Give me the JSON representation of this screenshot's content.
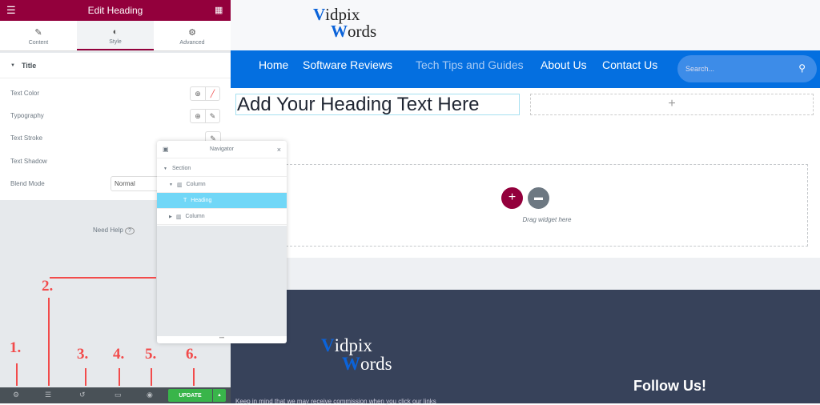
{
  "panel": {
    "title": "Edit Heading",
    "tabs": [
      "Content",
      "Style",
      "Advanced"
    ],
    "section": "Title",
    "rows": [
      "Text Color",
      "Typography",
      "Text Stroke",
      "Text Shadow",
      "Blend Mode"
    ],
    "blend_mode": "Normal",
    "help": "Need Help"
  },
  "bottom_bar": {
    "update": "UPDATE"
  },
  "navigator": {
    "title": "Navigator",
    "items": [
      "Section",
      "Column",
      "Heading",
      "Column"
    ]
  },
  "site": {
    "logo_top": "idpix",
    "logo_top_initial": "V",
    "logo_bottom": "ords",
    "logo_bottom_initial": "W",
    "menu": [
      "Home",
      "Software Reviews",
      "Tech Tips and Guides",
      "About Us",
      "Contact Us"
    ],
    "search_placeholder": "Search...",
    "heading": "Add Your Heading Text Here",
    "drag": "Drag widget here",
    "footer_text": "Keep in mind that we may receive commission when you click our links",
    "follow": "Follow Us!"
  },
  "annotations": [
    "1.",
    "2.",
    "3.",
    "4.",
    "5.",
    "6."
  ],
  "colors": {
    "accent": "#93003c",
    "nav_blue": "#046fe0",
    "update_green": "#39b54a",
    "annotation_red": "#f24b4b",
    "selected": "#71d7f7"
  }
}
